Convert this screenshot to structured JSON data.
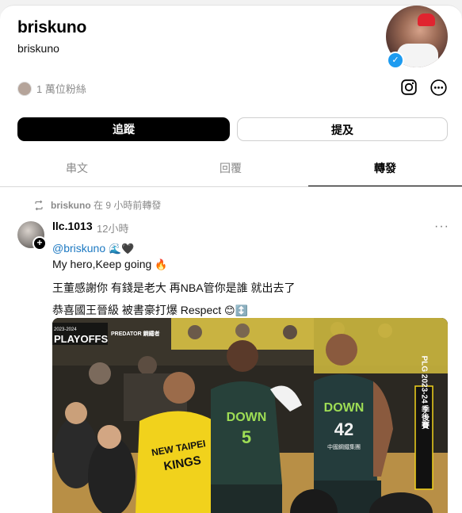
{
  "profile": {
    "name": "briskuno",
    "handle": "briskuno",
    "followers": "1 萬位粉絲",
    "verified_mark": "✓"
  },
  "actions": {
    "follow": "追蹤",
    "mention": "提及"
  },
  "tabs": [
    {
      "label": "串文",
      "active": false
    },
    {
      "label": "回覆",
      "active": false
    },
    {
      "label": "轉發",
      "active": true
    }
  ],
  "repost": {
    "by": "briskuno",
    "when": "在 9 小時前轉發"
  },
  "post": {
    "author": "llc.1013",
    "time": "12小時",
    "more": "···",
    "line1_mention": "@briskuno",
    "line1_emoji": "🌊🖤",
    "line2_text": "My hero,Keep going",
    "line2_emoji": "🔥",
    "line3": "王董感謝你 有錢是老大 再NBA管你是誰 就出去了",
    "line4_text": "恭喜國王晉級 被書豪打爆 Respect",
    "line4_emoji": "😊↕️",
    "photo": {
      "banner_top": "2023-2024",
      "banner": "PLAYOFFS",
      "banner_logo": "PREDATOR 鋼鐵者",
      "jersey_left_team": "DOWN",
      "jersey_left_number": "5",
      "jersey_right_team": "DOWN",
      "jersey_right_number": "42",
      "jersey_sponsor": "中國鋼鐵集團",
      "shirt_text_1": "NEW TAIPEI",
      "shirt_text_2": "KINGS",
      "side_banner": "PLG 2023-24 季後賽"
    }
  },
  "icons": [
    "verified-badge-icon",
    "instagram-icon",
    "more-options-icon",
    "repost-icon",
    "follow-plus-icon",
    "overflow-dots-icon"
  ]
}
